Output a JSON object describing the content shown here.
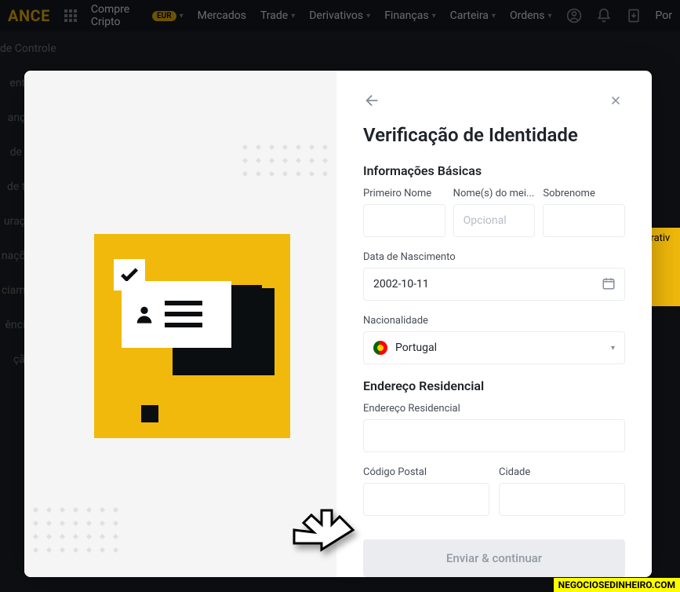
{
  "header": {
    "logo": "ANCE",
    "nav": {
      "buy": "Compre Cripto",
      "buy_pill": "EUR",
      "markets": "Mercados",
      "trade": "Trade",
      "derivatives": "Derivativos",
      "finance": "Finanças",
      "wallet": "Carteira",
      "orders": "Ordens",
      "lang": "Por"
    }
  },
  "sidebar": {
    "items": [
      "de Controle",
      "ento",
      "ança",
      "de R",
      "de ta",
      "uraçõ",
      "naçõe",
      "ciame",
      "ência",
      "ção"
    ]
  },
  "modal": {
    "title": "Verificação de Identidade",
    "section_basic": "Informações Básicas",
    "first_name_label": "Primeiro Nome",
    "middle_name_label": "Nome(s) do mei...",
    "middle_name_placeholder": "Opcional",
    "last_name_label": "Sobrenome",
    "dob_label": "Data de Nascimento",
    "dob_value": "2002-10-11",
    "nationality_label": "Nacionalidade",
    "nationality_value": "Portugal",
    "section_address": "Endereço Residencial",
    "address_label": "Endereço Residencial",
    "postal_label": "Código Postal",
    "city_label": "Cidade",
    "submit": "Enviar & continuar"
  },
  "yellow_side": "orativ",
  "watermark": "NEGOCIOSEDINHEIRO.COM"
}
